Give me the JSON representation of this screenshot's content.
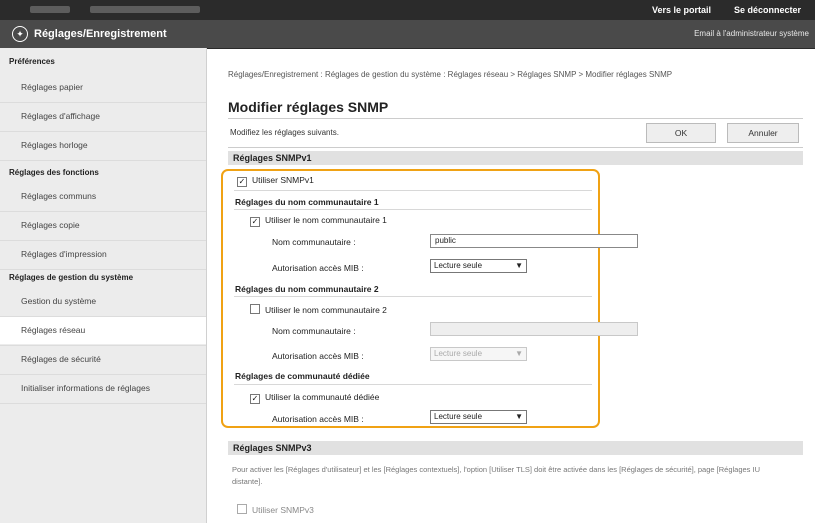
{
  "topbar": {
    "portal_link": "Vers le portail",
    "logout_link": "Se déconnecter"
  },
  "header": {
    "title": "Réglages/Enregistrement",
    "admin_email": "Email à l'administrateur système"
  },
  "sidebar": {
    "sections": [
      {
        "label": "Préférences"
      },
      {
        "label": "Réglages des fonctions"
      },
      {
        "label": "Réglages de gestion du système"
      }
    ],
    "items": [
      {
        "label": "Réglages papier"
      },
      {
        "label": "Réglages d'affichage"
      },
      {
        "label": "Réglages horloge"
      },
      {
        "label": "Réglages communs"
      },
      {
        "label": "Réglages copie"
      },
      {
        "label": "Réglages d'impression"
      },
      {
        "label": "Gestion du système"
      },
      {
        "label": "Réglages réseau"
      },
      {
        "label": "Réglages de sécurité"
      },
      {
        "label": "Initialiser informations de réglages"
      }
    ]
  },
  "main": {
    "breadcrumb": "Réglages/Enregistrement : Réglages de gestion du système : Réglages réseau > Réglages SNMP > Modifier réglages SNMP",
    "page_title": "Modifier réglages SNMP",
    "instruction": "Modifiez les réglages suivants.",
    "ok_label": "OK",
    "cancel_label": "Annuler",
    "snmpv1": {
      "header": "Réglages SNMPv1",
      "use_label": "Utiliser SNMPv1",
      "use_checked": true,
      "community1": {
        "header": "Réglages du nom communautaire 1",
        "use_label": "Utiliser le nom communautaire 1",
        "use_checked": true,
        "name_label": "Nom communautaire :",
        "name_value": "public",
        "mib_label": "Autorisation accès MIB :",
        "mib_value": "Lecture seule"
      },
      "community2": {
        "header": "Réglages du nom communautaire 2",
        "use_label": "Utiliser le nom communautaire 2",
        "use_checked": false,
        "name_label": "Nom communautaire :",
        "name_value": "",
        "mib_label": "Autorisation accès MIB :",
        "mib_value": "Lecture seule"
      },
      "dedicated": {
        "header": "Réglages de communauté dédiée",
        "use_label": "Utiliser la communauté dédiée",
        "use_checked": true,
        "mib_label": "Autorisation accès MIB :",
        "mib_value": "Lecture seule"
      }
    },
    "snmpv3": {
      "header": "Réglages SNMPv3",
      "note": "Pour activer les [Réglages d'utilisateur] et les [Réglages contextuels], l'option [Utiliser TLS] doit être activée dans les [Réglages de sécurité], page [Réglages IU distante].",
      "use_label": "Utiliser SNMPv3",
      "use_checked": false
    }
  },
  "colors": {
    "highlight_border": "#f0a214",
    "topbar": "#2b2b2b",
    "titlebar": "#4a4a4a",
    "sidebar": "#ececec"
  }
}
